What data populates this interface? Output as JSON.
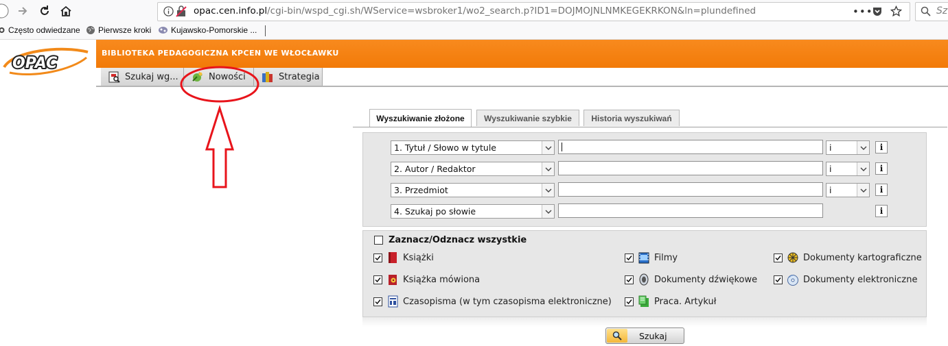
{
  "browser": {
    "url_host": "opac.cen.info.pl",
    "url_path": "/cgi-bin/wspd_cgi.sh/WService=wsbroker1/wo2_search.p?ID1=DOJMOJNLNMKEGEKRKON&ln=plundefined",
    "search_placeholder": "Sz",
    "bookmarks": [
      "Często odwiedzane",
      "Pierwsze kroki",
      "Kujawsko-Pomorskie ..."
    ]
  },
  "header": {
    "logo_text": "OPAC",
    "library_name": "BIBLIOTEKA PEDAGOGICZNA KPCEN WE WŁOCŁAWKU"
  },
  "main_tabs": [
    {
      "label": "Szukaj wg...",
      "icon": "search-map-icon"
    },
    {
      "label": "Nowości",
      "icon": "new-items-icon"
    },
    {
      "label": "Strategia",
      "icon": "books-icon"
    }
  ],
  "search_tabs": [
    {
      "label": "Wyszukiwanie złożone",
      "active": true
    },
    {
      "label": "Wyszukiwanie szybkie",
      "active": false
    },
    {
      "label": "Historia wyszukiwań",
      "active": false
    }
  ],
  "search_rows": [
    {
      "field": "1. Tytuł / Słowo w tytule",
      "value": "",
      "operator": "i",
      "info": "i"
    },
    {
      "field": "2. Autor / Redaktor",
      "value": "",
      "operator": "i",
      "info": "i"
    },
    {
      "field": "3. Przedmiot",
      "value": "",
      "operator": "i",
      "info": "i"
    },
    {
      "field": "4. Szukaj po słowie",
      "value": "",
      "operator": "",
      "info": "i"
    }
  ],
  "select_all_label": "Zaznacz/Odznacz wszystkie",
  "document_types": [
    {
      "label": "Książki",
      "checked": true,
      "icon": "book-icon"
    },
    {
      "label": "Książka mówiona",
      "checked": true,
      "icon": "audiobook-icon"
    },
    {
      "label": "Czasopisma (w tym czasopisma elektroniczne)",
      "checked": true,
      "icon": "periodical-icon"
    },
    {
      "label": "Filmy",
      "checked": true,
      "icon": "film-icon"
    },
    {
      "label": "Dokumenty dźwiękowe",
      "checked": true,
      "icon": "speaker-icon"
    },
    {
      "label": "Praca. Artykuł",
      "checked": true,
      "icon": "article-icon"
    },
    {
      "label": "Dokumenty kartograficzne",
      "checked": true,
      "icon": "map-icon"
    },
    {
      "label": "Dokumenty elektroniczne",
      "checked": true,
      "icon": "cd-icon"
    }
  ],
  "search_button_label": "Szukaj",
  "colors": {
    "accent_orange": "#f27a08",
    "annotation_red": "#e8141b",
    "panel_grey": "#e7e7e7"
  }
}
